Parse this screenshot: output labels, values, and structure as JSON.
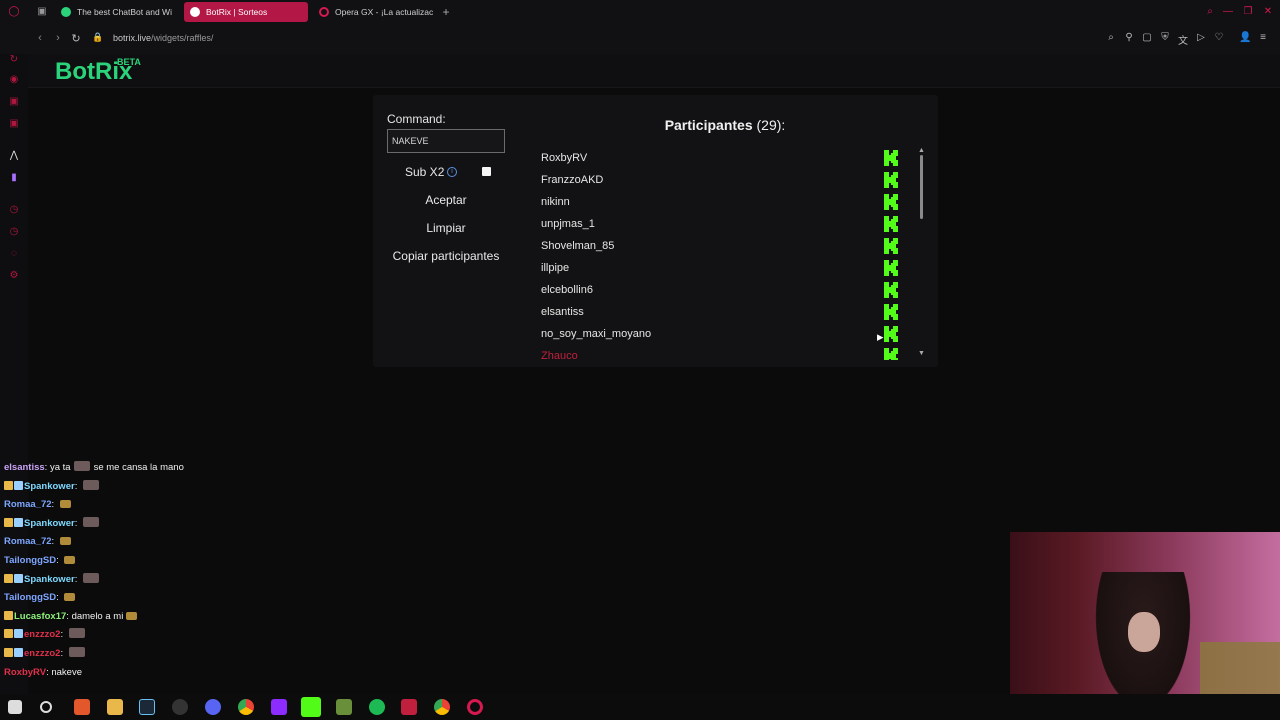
{
  "browser": {
    "tabs": [
      {
        "label": "The best ChatBot and Wi"
      },
      {
        "label": "BotRix | Sorteos"
      },
      {
        "label": "Opera GX - ¡La actualizac"
      }
    ],
    "url_host": "botrix.live",
    "url_path": "/widgets/raffles/"
  },
  "site": {
    "logo": "BotRix",
    "beta": "BETA"
  },
  "raffle": {
    "command_label": "Command:",
    "command_value": "NAKEVE",
    "subx2_label": "Sub X2",
    "accept_label": "Aceptar",
    "clear_label": "Limpiar",
    "copy_label": "Copiar participantes",
    "participants_title": "Participantes",
    "participants_count": "(29):",
    "participants": [
      {
        "name": "RoxbyRV"
      },
      {
        "name": "FranzzoAKD"
      },
      {
        "name": "nikinn"
      },
      {
        "name": "unpjmas_1"
      },
      {
        "name": "Shovelman_85"
      },
      {
        "name": "illpipe"
      },
      {
        "name": "elcebollin6"
      },
      {
        "name": "elsantiss"
      },
      {
        "name": "no_soy_maxi_moyano"
      },
      {
        "name": "Zhauco"
      }
    ],
    "kick_color": "#53fc18"
  },
  "chat": [
    {
      "user": "elsantiss",
      "color": "#c9a3f7",
      "msg": "ya ta",
      "emote": true,
      "msg2": "se me cansa la mano",
      "badges": 0
    },
    {
      "user": "Spankower",
      "color": "#7fd9ff",
      "msg": "",
      "emote": true,
      "badges": 2
    },
    {
      "user": "Romaa_72",
      "color": "#7ea6ff",
      "msg": "",
      "emote_small": true,
      "badges": 0
    },
    {
      "user": "Spankower",
      "color": "#7fd9ff",
      "msg": "",
      "emote": true,
      "badges": 2
    },
    {
      "user": "Romaa_72",
      "color": "#7ea6ff",
      "msg": "",
      "emote_small": true,
      "badges": 0
    },
    {
      "user": "TailonggSD",
      "color": "#7ea6ff",
      "msg": "",
      "emote_small": true,
      "badges": 0
    },
    {
      "user": "Spankower",
      "color": "#7fd9ff",
      "msg": "",
      "emote": true,
      "badges": 2
    },
    {
      "user": "TailonggSD",
      "color": "#7ea6ff",
      "msg": "",
      "emote_small": true,
      "badges": 0
    },
    {
      "user": "Lucasfox17",
      "color": "#8df27a",
      "msg": "damelo a mi",
      "emote_small": true,
      "badges": 1
    },
    {
      "user": "enzzzo2",
      "color": "#e0304a",
      "msg": "",
      "emote": true,
      "badges": 2
    },
    {
      "user": "enzzzo2",
      "color": "#e0304a",
      "msg": "",
      "emote": true,
      "badges": 2
    },
    {
      "user": "RoxbyRV",
      "color": "#e0304a",
      "msg": "nakeve",
      "badges": 0
    }
  ]
}
